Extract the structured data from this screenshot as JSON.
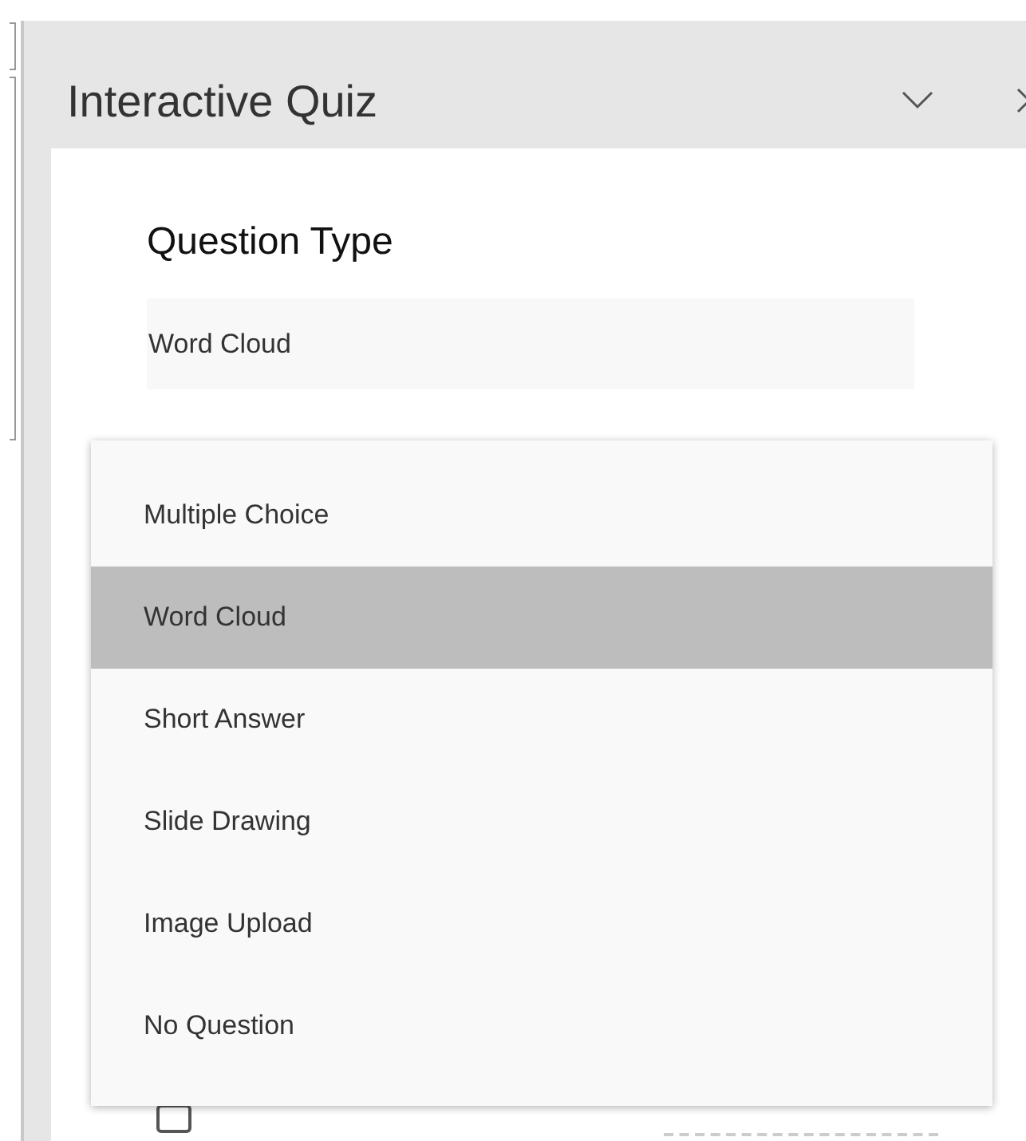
{
  "panel": {
    "title": "Interactive Quiz"
  },
  "question_type": {
    "heading": "Question Type",
    "value": "Word Cloud"
  },
  "dropdown": {
    "options": [
      {
        "label": "Multiple Choice",
        "selected": false
      },
      {
        "label": "Word Cloud",
        "selected": true
      },
      {
        "label": "Short Answer",
        "selected": false
      },
      {
        "label": "Slide Drawing",
        "selected": false
      },
      {
        "label": "Image Upload",
        "selected": false
      },
      {
        "label": "No Question",
        "selected": false
      }
    ]
  },
  "close_submission": {
    "checked": false
  }
}
